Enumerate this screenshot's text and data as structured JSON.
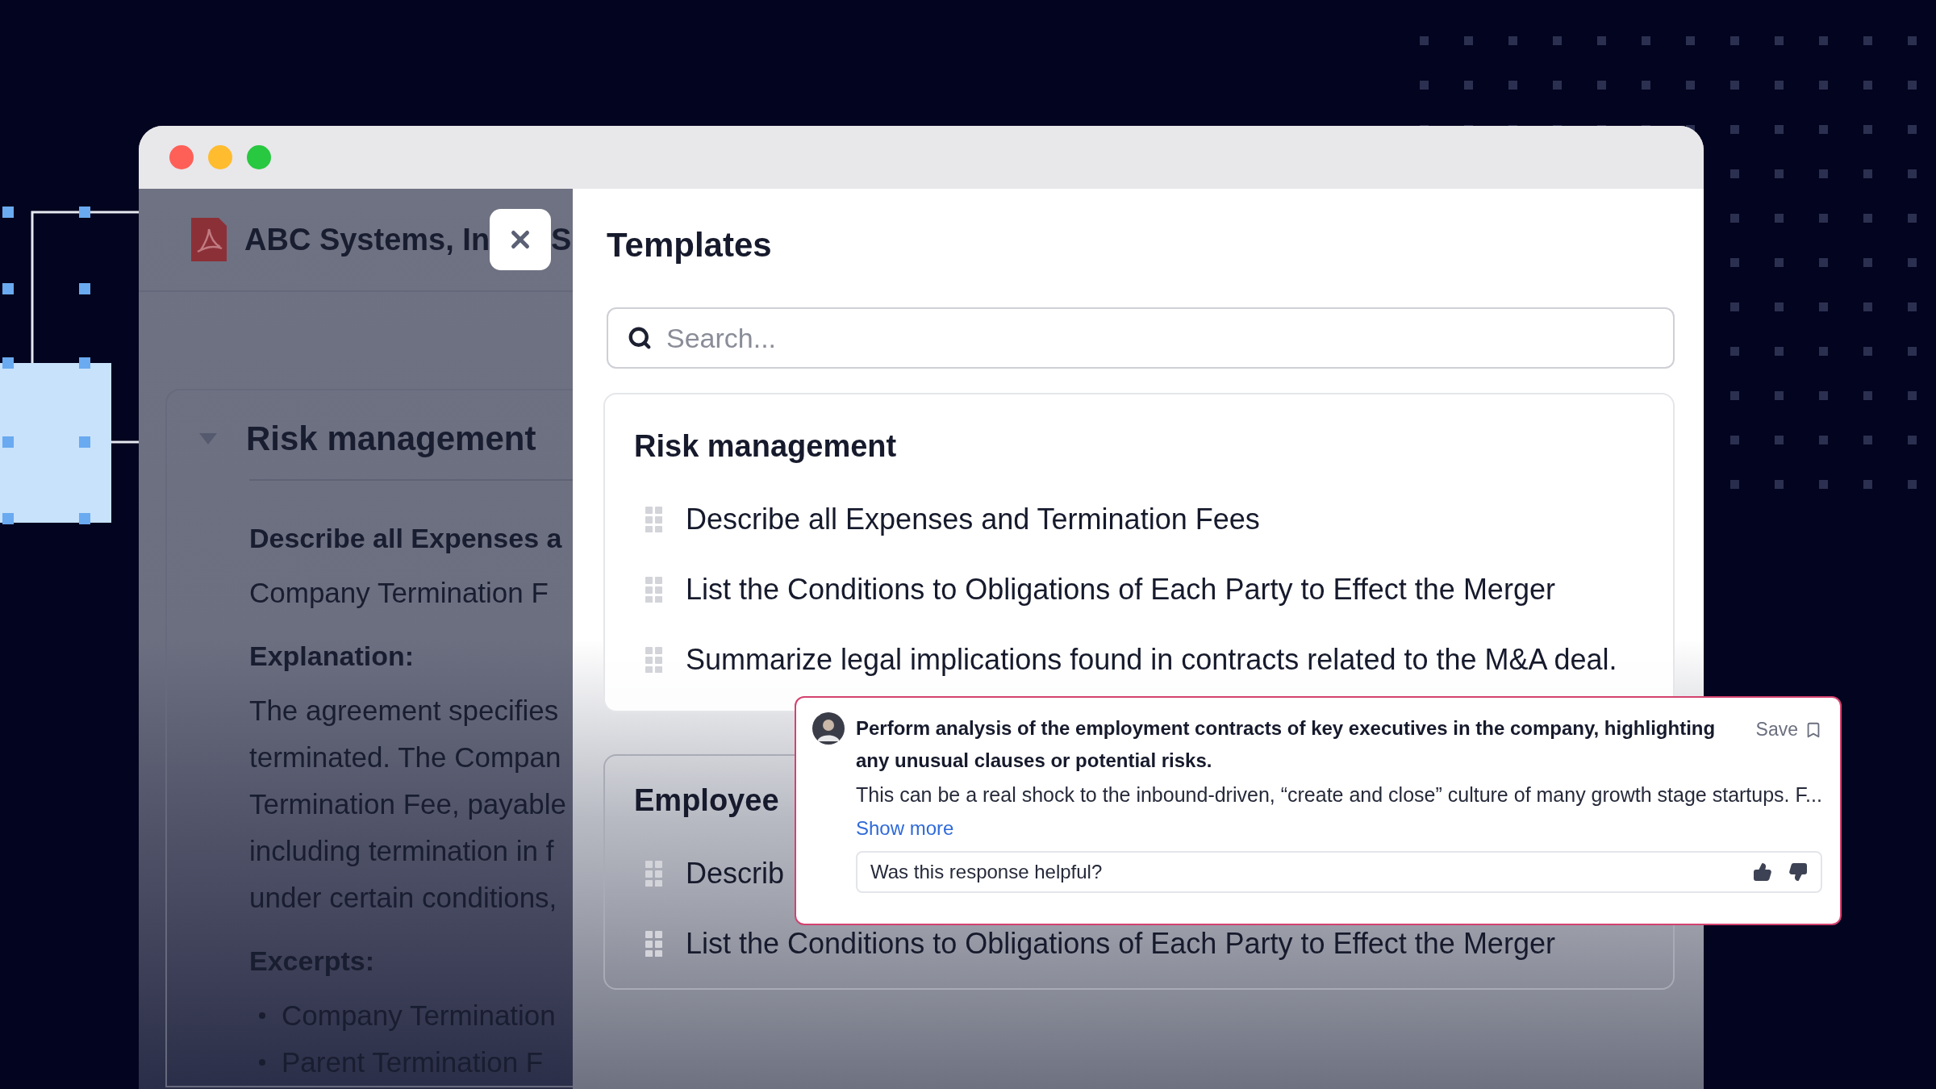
{
  "document": {
    "title_start": "ABC Systems, In",
    "title_end": "S",
    "section": {
      "title": "Risk management",
      "expanded": true,
      "question": "Describe all Expenses a",
      "answer": "Company Termination F",
      "explanation_label": "Explanation:",
      "explanation_lines": [
        "The agreement specifies",
        "terminated. The Compan",
        "Termination Fee, payable",
        "including termination in f",
        "under certain conditions,"
      ],
      "excerpts_label": "Excerpts:",
      "excerpts": [
        "Company Termination",
        "Parent Termination F"
      ]
    }
  },
  "templates": {
    "title": "Templates",
    "search": {
      "placeholder": "Search..."
    },
    "groups": [
      {
        "title": "Risk management",
        "items": [
          "Describe all Expenses and Termination Fees",
          "List the Conditions to Obligations of Each Party to Effect the Merger",
          "Summarize legal implications found in contracts related to the M&A deal."
        ]
      },
      {
        "title": "Employee",
        "items": [
          "Describ",
          "List the Conditions to Obligations of Each Party to Effect the Merger"
        ]
      }
    ]
  },
  "response_card": {
    "prompt": "Perform analysis of the employment contracts of key executives in the company, highlighting any unusual clauses or potential risks.",
    "save": "Save",
    "body": "This can be a real shock to the inbound-driven, “create and close” culture of many growth stage startups. F...",
    "show_more": "Show more",
    "feedback": {
      "question": "Was this response helpful?"
    }
  }
}
